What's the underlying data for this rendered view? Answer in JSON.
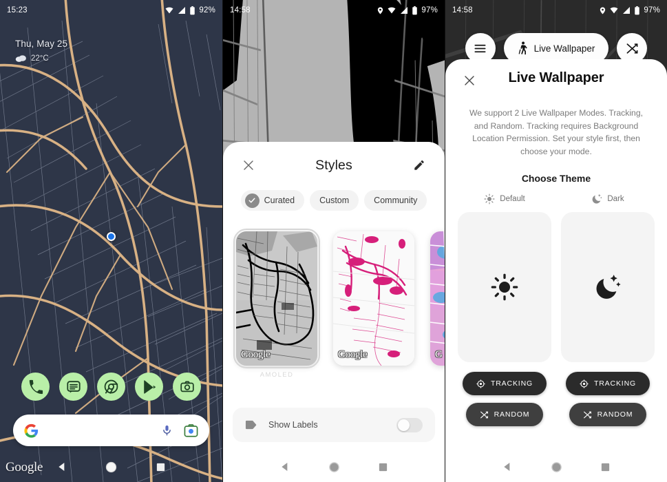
{
  "panels": [
    {
      "id": "home-wallpaper",
      "status": {
        "time": "15:23",
        "battery": "92%",
        "wifi_icon": "wifi-icon",
        "signal_icon": "signal-icon",
        "battery_icon": "battery-icon"
      },
      "widget": {
        "date": "Thu, May 25",
        "temp": "22°C",
        "weather_icon": "cloud-icon"
      },
      "dock": [
        {
          "name": "phone",
          "icon": "phone-icon"
        },
        {
          "name": "messages",
          "icon": "messages-icon"
        },
        {
          "name": "chrome",
          "icon": "chrome-icon"
        },
        {
          "name": "play-store",
          "icon": "play-store-icon"
        },
        {
          "name": "camera",
          "icon": "camera-icon"
        }
      ],
      "search": {
        "placeholder": "",
        "value": "",
        "g_icon": "google-g-icon",
        "mic_icon": "microphone-icon",
        "lens_icon": "google-lens-icon"
      },
      "watermark": "Google",
      "map_colors": {
        "land": "#2e3648",
        "road": "#d8b184",
        "minor_road": "#8e94a4",
        "dot": "#1a73e8"
      }
    },
    {
      "id": "styles-sheet",
      "status": {
        "time": "14:58",
        "battery": "97%",
        "location_icon": "location-pin-icon",
        "wifi_icon": "wifi-icon",
        "signal_icon": "signal-icon",
        "battery_icon": "battery-icon"
      },
      "sheet": {
        "title": "Styles",
        "close_icon": "close-icon",
        "edit_icon": "pencil-edit-icon",
        "chips": [
          {
            "label": "Curated",
            "selected": true,
            "icon": "check-circle-icon"
          },
          {
            "label": "Custom",
            "selected": false
          },
          {
            "label": "Community",
            "selected": false
          }
        ],
        "cards": [
          {
            "label": "AMOLED",
            "watermark": "Google",
            "selected": true,
            "theme": "grayscale"
          },
          {
            "label": "",
            "watermark": "Google",
            "selected": false,
            "theme": "pink"
          },
          {
            "label": "",
            "watermark": "G",
            "selected": false,
            "theme": "vibrant"
          }
        ],
        "show_labels": {
          "label": "Show Labels",
          "icon": "label-tag-icon",
          "enabled": false
        }
      }
    },
    {
      "id": "live-wallpaper-sheet",
      "status": {
        "time": "14:58",
        "battery": "97%",
        "location_icon": "location-pin-icon",
        "wifi_icon": "wifi-icon",
        "signal_icon": "signal-icon",
        "battery_icon": "battery-icon"
      },
      "top_controls": {
        "menu_icon": "hamburger-menu-icon",
        "pill_label": "Live Wallpaper",
        "pill_icon": "walking-person-icon",
        "shuffle_icon": "shuffle-icon"
      },
      "sheet": {
        "close_icon": "close-icon",
        "title": "Live Wallpaper",
        "description": "We support 2 Live Wallpaper Modes. Tracking, and Random. Tracking requires Background Location Permission. Set your style first, then choose your mode.",
        "choose_theme": "Choose Theme",
        "themes": [
          {
            "name": "Default",
            "head_icon": "sun-icon",
            "card_icon": "sun-icon",
            "buttons": [
              {
                "label": "TRACKING",
                "icon": "gps-target-icon",
                "style": "primary"
              },
              {
                "label": "RANDOM",
                "icon": "shuffle-icon",
                "style": "secondary"
              }
            ]
          },
          {
            "name": "Dark",
            "head_icon": "moon-stars-icon",
            "card_icon": "moon-stars-icon",
            "buttons": [
              {
                "label": "TRACKING",
                "icon": "gps-target-icon",
                "style": "primary"
              },
              {
                "label": "RANDOM",
                "icon": "shuffle-icon",
                "style": "secondary"
              }
            ]
          }
        ]
      }
    }
  ],
  "navbar": {
    "back_icon": "back-triangle-icon",
    "home_icon": "home-circle-icon",
    "recents_icon": "recents-square-icon"
  }
}
